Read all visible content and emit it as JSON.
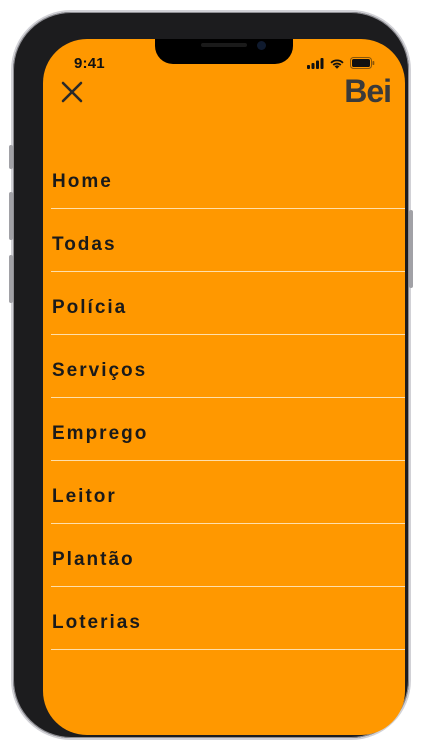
{
  "status_bar": {
    "time": "9:41"
  },
  "header": {
    "close_icon": "close-icon",
    "logo_text": "Bei"
  },
  "menu": {
    "items": [
      {
        "label": "Home"
      },
      {
        "label": "Todas"
      },
      {
        "label": "Polícia"
      },
      {
        "label": "Serviços"
      },
      {
        "label": "Emprego"
      },
      {
        "label": "Leitor"
      },
      {
        "label": "Plantão"
      },
      {
        "label": "Loterias"
      }
    ]
  },
  "colors": {
    "background": "#ff9800",
    "text": "#1a1a1a",
    "logo": "#3a3a3a",
    "divider": "#ffebc8"
  }
}
